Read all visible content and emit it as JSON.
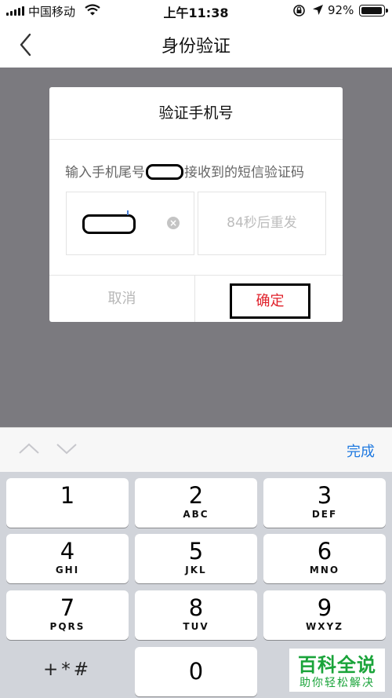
{
  "status_bar": {
    "carrier": "中国移动",
    "time": "上午11:38",
    "battery": "92%",
    "battery_level": 0.92
  },
  "nav": {
    "title": "身份验证",
    "back_icon": "chevron-left-icon"
  },
  "dialog": {
    "title": "验证手机号",
    "desc_prefix": "输入手机尾号",
    "desc_suffix": "接收到的短信验证码",
    "resend_label": "84秒后重发",
    "cancel_label": "取消",
    "confirm_label": "确定",
    "confirm_color": "#e0202a"
  },
  "keyboard": {
    "done_label": "完成",
    "done_color": "#1f79e0",
    "keys": [
      {
        "digit": "1",
        "letters": ""
      },
      {
        "digit": "2",
        "letters": "ABC"
      },
      {
        "digit": "3",
        "letters": "DEF"
      },
      {
        "digit": "4",
        "letters": "GHI"
      },
      {
        "digit": "5",
        "letters": "JKL"
      },
      {
        "digit": "6",
        "letters": "MNO"
      },
      {
        "digit": "7",
        "letters": "PQRS"
      },
      {
        "digit": "8",
        "letters": "TUV"
      },
      {
        "digit": "9",
        "letters": "WXYZ"
      },
      {
        "digit": "0",
        "letters": ""
      }
    ],
    "symbols_label": "+*#"
  },
  "watermark": {
    "title": "百科全说",
    "subtitle": "助你轻松解决"
  }
}
